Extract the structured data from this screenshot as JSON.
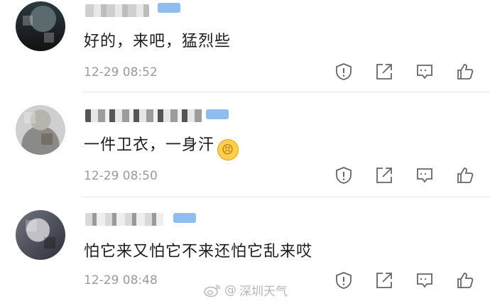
{
  "comments": [
    {
      "text": "好的，来吧，猛烈些",
      "time": "12-29 08:52"
    },
    {
      "text": "一件卫衣，一身汗",
      "emoji": "😣",
      "time": "12-29 08:50"
    },
    {
      "text": "怕它来又怕它不来还怕它乱来哎",
      "time": "12-29 08:48"
    }
  ],
  "icons": [
    "report-icon",
    "share-icon",
    "reply-icon",
    "like-icon"
  ],
  "watermark": {
    "at": "@",
    "text": "深圳天气"
  },
  "colors": {
    "badge": "#8fbdf0",
    "meta_text": "#9a9a9a",
    "separator": "#e6e6e6"
  }
}
